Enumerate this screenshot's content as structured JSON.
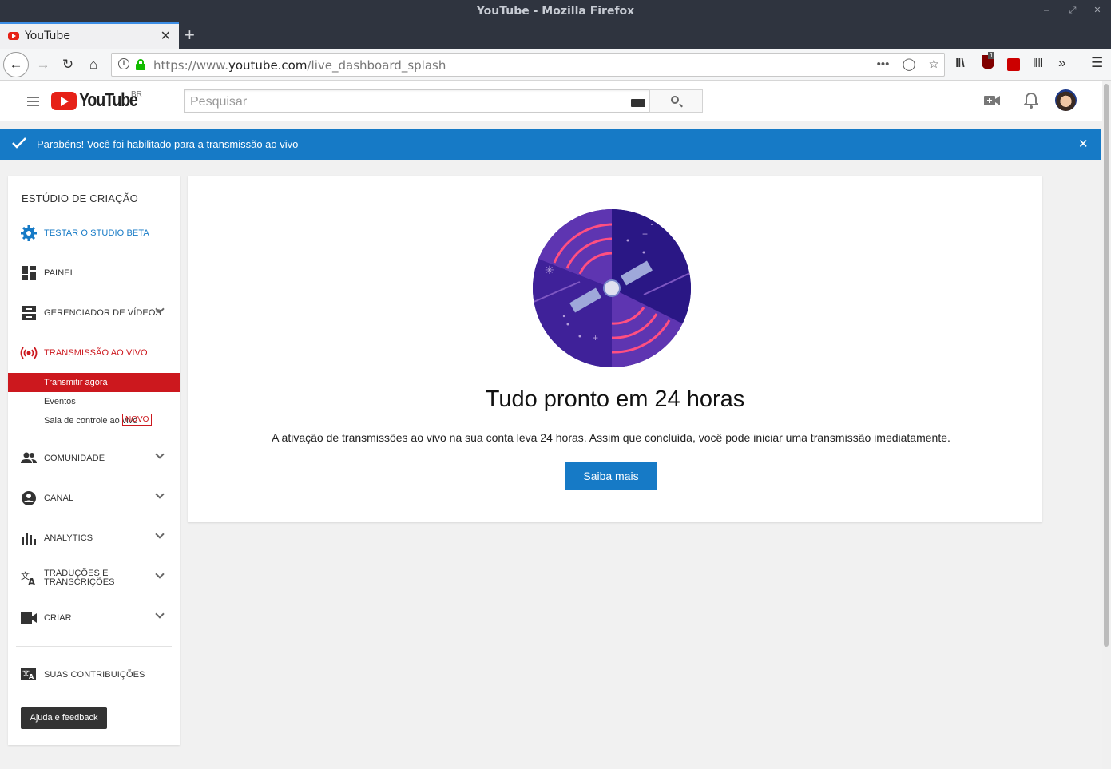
{
  "window": {
    "title": "YouTube - Mozilla Firefox"
  },
  "browser": {
    "tab_title": "YouTube",
    "url_prefix": "https://www.",
    "url_host": "youtube.com",
    "url_path": "/live_dashboard_splash",
    "ublock_badge": "1"
  },
  "header": {
    "logo_text": "YouTube",
    "region": "BR",
    "search_placeholder": "Pesquisar"
  },
  "banner": {
    "message": "Parabéns! Você foi habilitado para a transmissão ao vivo",
    "color": "#167ac6"
  },
  "sidebar": {
    "title": "ESTÚDIO DE CRIAÇÃO",
    "items": [
      {
        "label": "TESTAR O STUDIO BETA",
        "icon": "gear-icon",
        "color": "#167ac6"
      },
      {
        "label": "PAINEL",
        "icon": "dashboard-icon"
      },
      {
        "label": "GERENCIADOR DE VÍDEOS",
        "icon": "video-manager-icon"
      },
      {
        "label": "TRANSMISSÃO AO VIVO",
        "icon": "live-broadcast-icon",
        "color": "#cc181e"
      },
      {
        "label": "COMUNIDADE",
        "icon": "community-icon"
      },
      {
        "label": "CANAL",
        "icon": "channel-icon"
      },
      {
        "label": "ANALYTICS",
        "icon": "analytics-icon"
      },
      {
        "label": "TRADUÇÕES E TRANSCRIÇÕES",
        "icon": "translate-icon"
      },
      {
        "label": "CRIAR",
        "icon": "create-icon"
      },
      {
        "label": "SUAS CONTRIBUIÇÕES",
        "icon": "contributions-icon"
      }
    ],
    "live_subitems": [
      {
        "label": "Transmitir agora",
        "active": true
      },
      {
        "label": "Eventos"
      },
      {
        "label": "Sala de controle ao vivo"
      }
    ],
    "new_badge": "NOVO",
    "help_button": "Ajuda e feedback"
  },
  "main": {
    "heading": "Tudo pronto em 24 horas",
    "description": "A ativação de transmissões ao vivo na sua conta leva 24 horas. Assim que concluída, você pode iniciar uma transmissão imediatamente.",
    "button": "Saiba mais"
  }
}
